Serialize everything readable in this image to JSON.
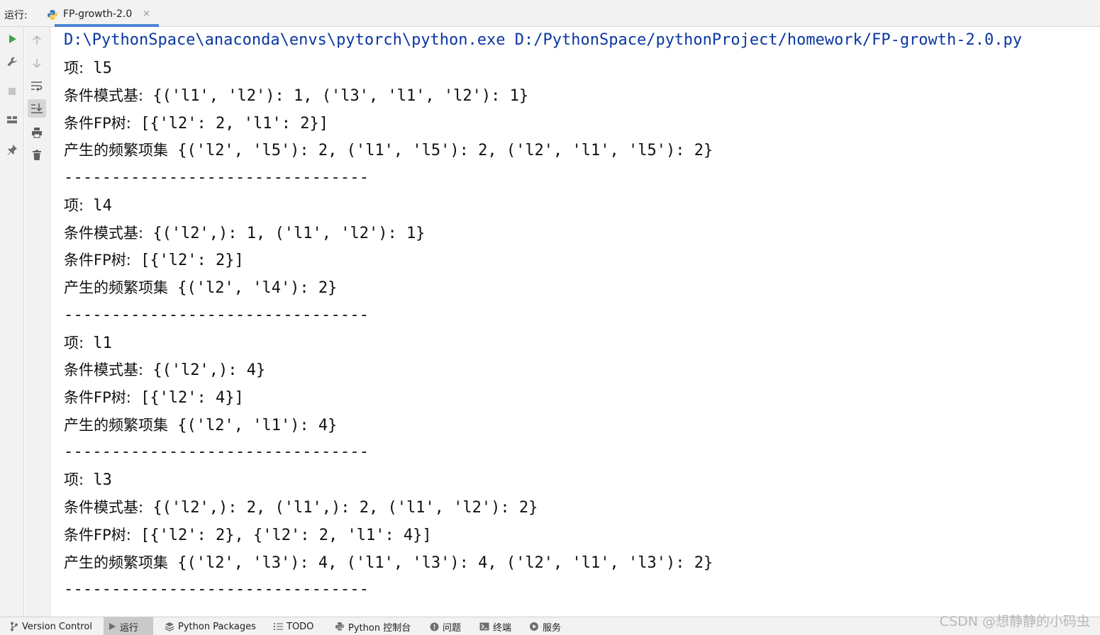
{
  "topbar": {
    "run_label": "运行:",
    "tab_title": "FP-growth-2.0",
    "tab_close": "×"
  },
  "console": {
    "command": "D:\\PythonSpace\\anaconda\\envs\\pytorch\\python.exe D:/PythonSpace/pythonProject/homework/FP-growth-2.0.py",
    "blocks": [
      {
        "item_label": "项:",
        "item_value": " l5",
        "base_label": "条件模式基:",
        "base_value": " {('l1', 'l2'): 1, ('l3', 'l1', 'l2'): 1}",
        "tree_label": "条件FP树:",
        "tree_value": " [{'l2': 2, 'l1': 2}]",
        "freq_label": "产生的频繁项集",
        "freq_value": " {('l2', 'l5'): 2, ('l1', 'l5'): 2, ('l2', 'l1', 'l5'): 2}",
        "separator": "--------------------------------"
      },
      {
        "item_label": "项:",
        "item_value": " l4",
        "base_label": "条件模式基:",
        "base_value": " {('l2',): 1, ('l1', 'l2'): 1}",
        "tree_label": "条件FP树:",
        "tree_value": " [{'l2': 2}]",
        "freq_label": "产生的频繁项集",
        "freq_value": " {('l2', 'l4'): 2}",
        "separator": "--------------------------------"
      },
      {
        "item_label": "项:",
        "item_value": " l1",
        "base_label": "条件模式基:",
        "base_value": " {('l2',): 4}",
        "tree_label": "条件FP树:",
        "tree_value": " [{'l2': 4}]",
        "freq_label": "产生的频繁项集",
        "freq_value": " {('l2', 'l1'): 4}",
        "separator": "--------------------------------"
      },
      {
        "item_label": "项:",
        "item_value": " l3",
        "base_label": "条件模式基:",
        "base_value": " {('l2',): 2, ('l1',): 2, ('l1', 'l2'): 2}",
        "tree_label": "条件FP树:",
        "tree_value": " [{'l2': 2}, {'l2': 2, 'l1': 4}]",
        "freq_label": "产生的频繁项集",
        "freq_value": " {('l2', 'l3'): 4, ('l1', 'l3'): 4, ('l2', 'l1', 'l3'): 2}",
        "separator": "--------------------------------"
      }
    ]
  },
  "bottombar": {
    "items": [
      "Version Control",
      "运行",
      "Python Packages",
      "TODO",
      "Python 控制台",
      "问题",
      "终端",
      "服务"
    ]
  },
  "watermark": "CSDN @想静静的小码虫",
  "colors": {
    "command_text": "#0a37a2",
    "tab_underline": "#4a83d4",
    "run_green": "#3fa34d"
  }
}
